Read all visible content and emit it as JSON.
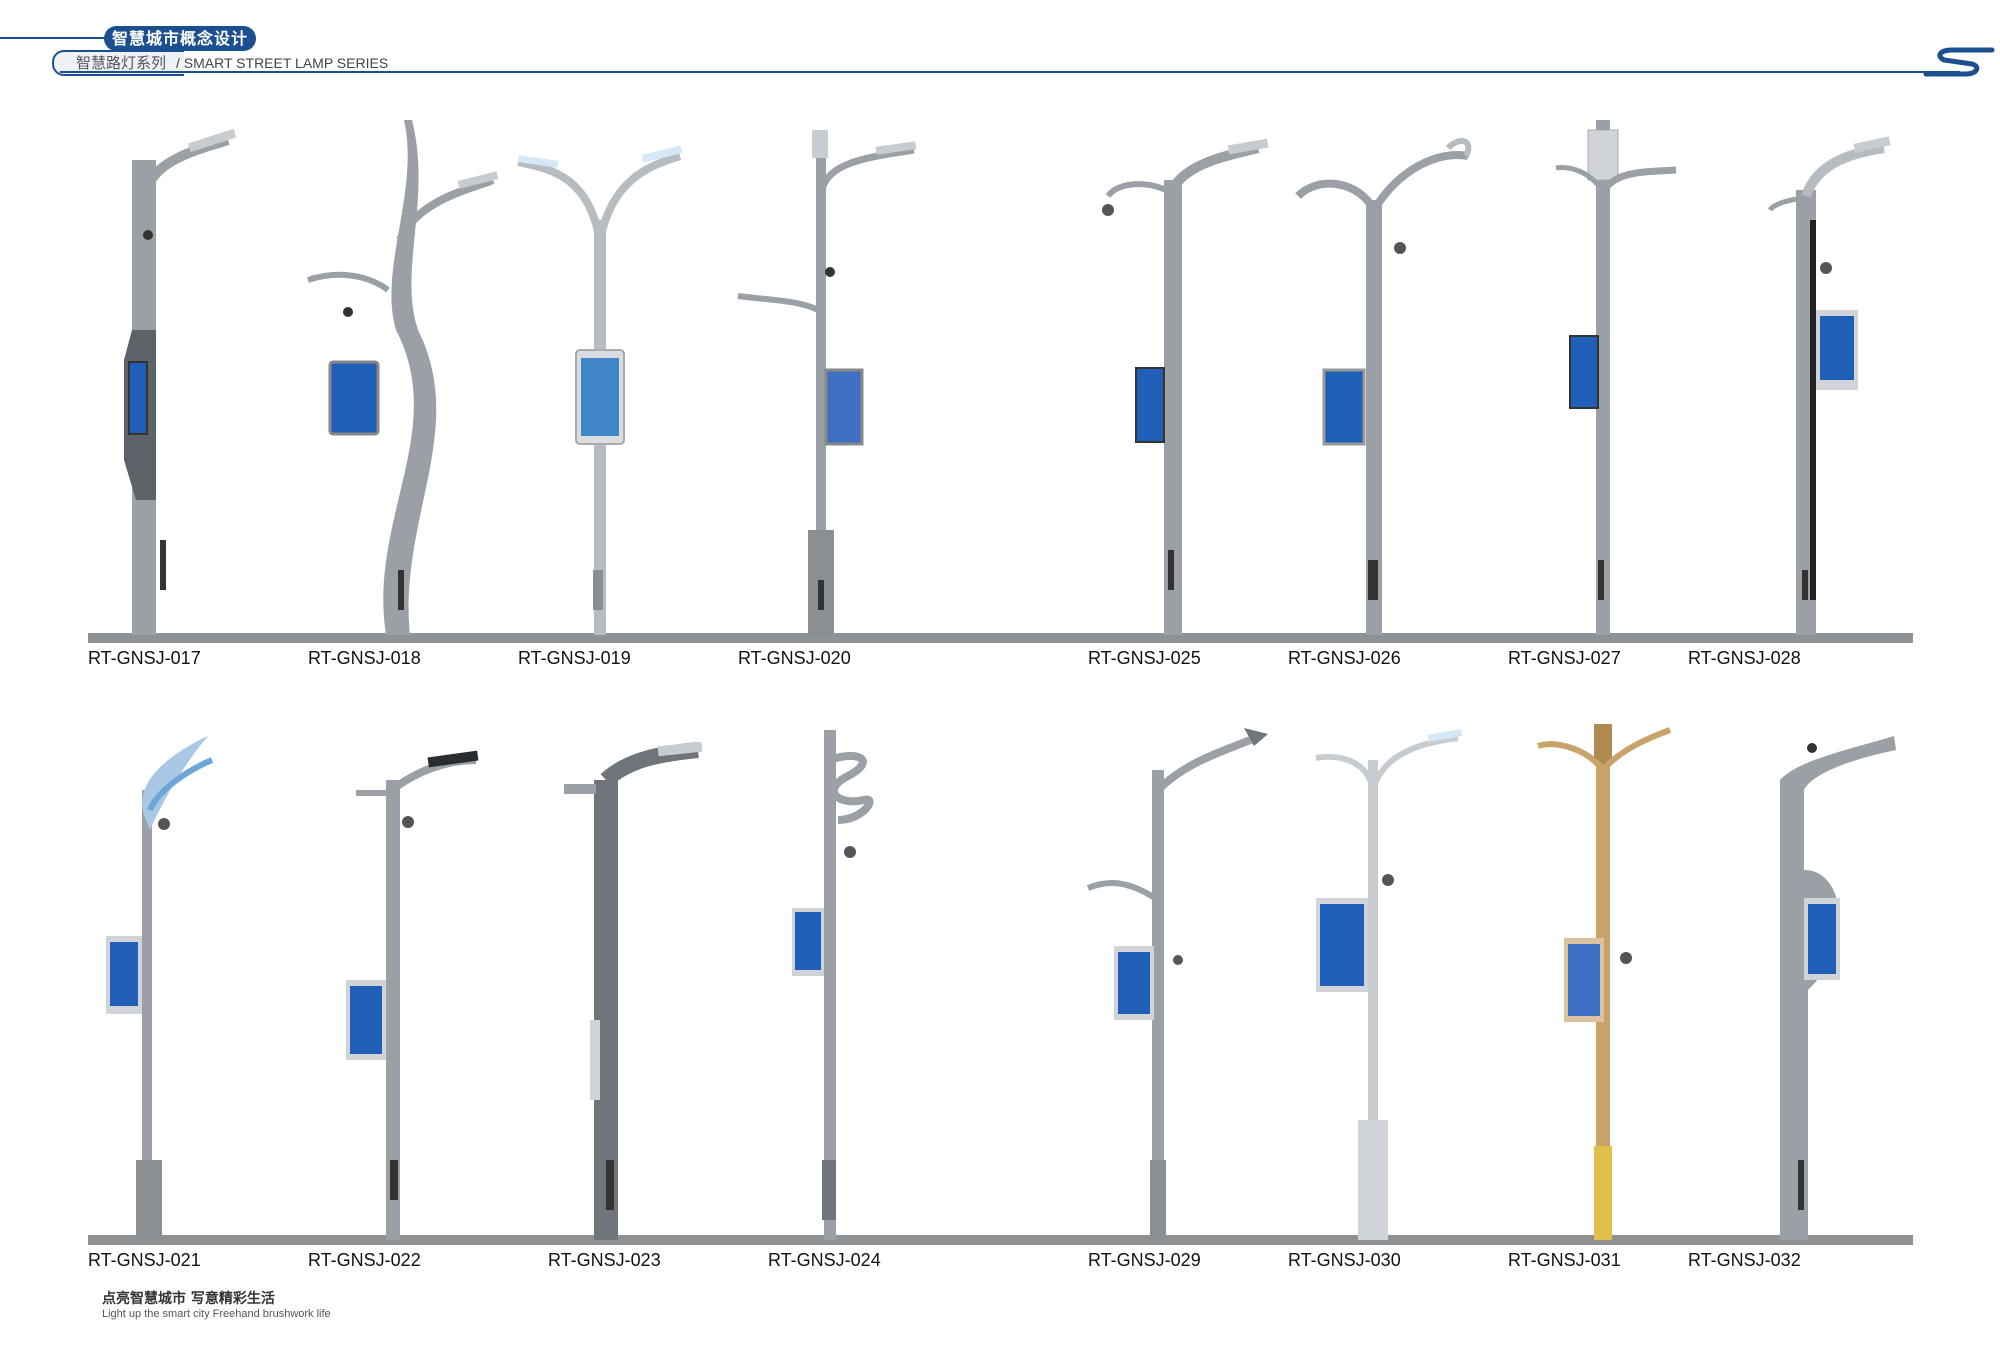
{
  "header": {
    "badge": "智慧城市概念设计",
    "subtitle_cn": "智慧路灯系列",
    "subtitle_en": "/ SMART STREET LAMP SERIES"
  },
  "colors": {
    "brand_blue": "#1b4f8f",
    "pole_gray": "#9aa0a6",
    "pole_dark": "#6f757b",
    "screen_blue": "#1f5fb8",
    "ground": "#8f9295",
    "gold_pole": "#c9a46a"
  },
  "rows": [
    {
      "lamps": [
        {
          "model": "RT-GNSJ-017",
          "style": "bent-column",
          "screen": "blue"
        },
        {
          "model": "RT-GNSJ-018",
          "style": "twist-blade",
          "screen": "blue"
        },
        {
          "model": "RT-GNSJ-019",
          "style": "double-arm",
          "screen": "city"
        },
        {
          "model": "RT-GNSJ-020",
          "style": "5g-double-arm",
          "screen": "city"
        },
        {
          "model": "RT-GNSJ-025",
          "style": "curved-arm",
          "screen": "blue"
        },
        {
          "model": "RT-GNSJ-026",
          "style": "scroll-arm",
          "screen": "blue"
        },
        {
          "model": "RT-GNSJ-027",
          "style": "antenna-top",
          "screen": "blue"
        },
        {
          "model": "RT-GNSJ-028",
          "style": "curved-arm-dark",
          "screen": "blue"
        }
      ]
    },
    {
      "lamps": [
        {
          "model": "RT-GNSJ-021",
          "style": "wave-arm",
          "screen": "blue"
        },
        {
          "model": "RT-GNSJ-022",
          "style": "flat-arm",
          "screen": "blue"
        },
        {
          "model": "RT-GNSJ-023",
          "style": "box-column",
          "screen": "none"
        },
        {
          "model": "RT-GNSJ-024",
          "style": "spiral-top",
          "screen": "blue"
        },
        {
          "model": "RT-GNSJ-029",
          "style": "double-hook",
          "screen": "blue"
        },
        {
          "model": "RT-GNSJ-030",
          "style": "y-arm-white",
          "screen": "blue"
        },
        {
          "model": "RT-GNSJ-031",
          "style": "gold-flower",
          "screen": "city"
        },
        {
          "model": "RT-GNSJ-032",
          "style": "c-column",
          "screen": "blue"
        }
      ]
    }
  ],
  "footer": {
    "slogan_cn": "点亮智慧城市  写意精彩生活",
    "slogan_en": "Light up the smart city Freehand brushwork life"
  },
  "icons": [
    "brand-s-logo-icon",
    "cctv-camera-icon",
    "led-lamp-head-icon"
  ]
}
